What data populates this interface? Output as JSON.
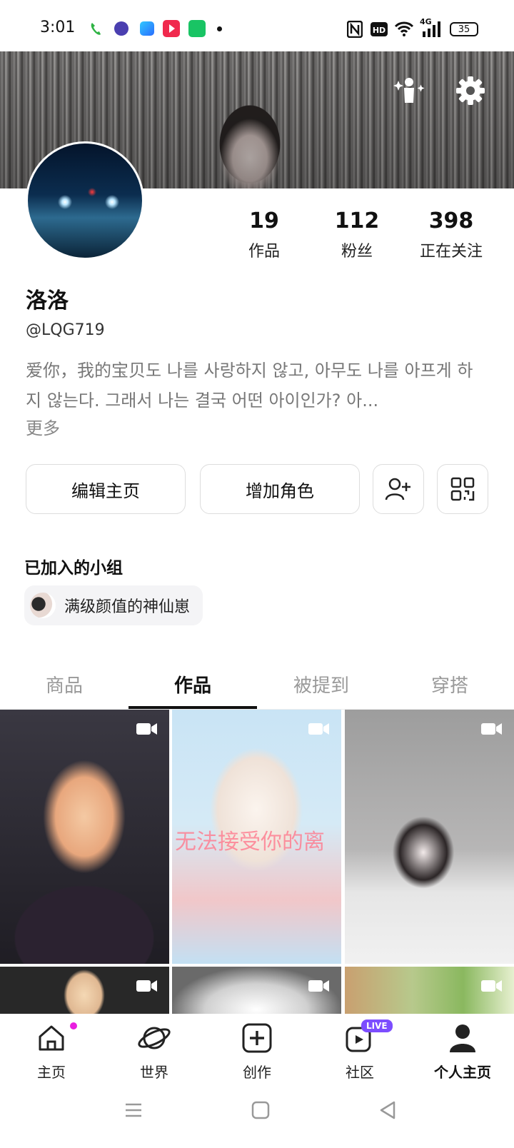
{
  "status_bar": {
    "time": "3:01",
    "battery": "35",
    "network": "4G",
    "icons": [
      "phone-icon",
      "app-icon",
      "app-icon",
      "video-app-icon",
      "app-icon",
      "dot-icon",
      "nfc-icon",
      "hd-icon",
      "wifi-icon",
      "signal-icon",
      "battery-icon"
    ]
  },
  "profile": {
    "name": "洛洛",
    "handle": "@LQG719",
    "bio": "爱你，我的宝贝도 나를 사랑하지 않고, 아무도 나를 아프게 하지 않는다. 그래서 나는 결국 어떤 아이인가? 아...",
    "more_label": "更多",
    "stats": [
      {
        "num": "19",
        "label": "作品"
      },
      {
        "num": "112",
        "label": "粉丝"
      },
      {
        "num": "398",
        "label": "正在关注"
      }
    ]
  },
  "actions": {
    "edit_label": "编辑主页",
    "add_role_label": "增加角色",
    "icons": [
      "add-friend-icon",
      "qr-code-icon"
    ]
  },
  "groups": {
    "title": "已加入的小组",
    "items": [
      {
        "name": "满级颜值的神仙崽"
      }
    ]
  },
  "tabs": [
    {
      "label": "商品",
      "active": false
    },
    {
      "label": "作品",
      "active": true
    },
    {
      "label": "被提到",
      "active": false
    },
    {
      "label": "穿搭",
      "active": false
    }
  ],
  "grid": {
    "overlay_text": "无法接受你的离",
    "icon": "video-camera-icon"
  },
  "bottom_nav": [
    {
      "label": "主页",
      "icon": "home-icon",
      "active": false
    },
    {
      "label": "世界",
      "icon": "planet-icon",
      "active": false
    },
    {
      "label": "创作",
      "icon": "create-plus-icon",
      "active": false
    },
    {
      "label": "社区",
      "icon": "community-icon",
      "active": false,
      "badge": "LIVE"
    },
    {
      "label": "个人主页",
      "icon": "person-icon",
      "active": true
    }
  ],
  "colors": {
    "accent": "#7c4dff",
    "notification_dot": "#e91ee0"
  }
}
